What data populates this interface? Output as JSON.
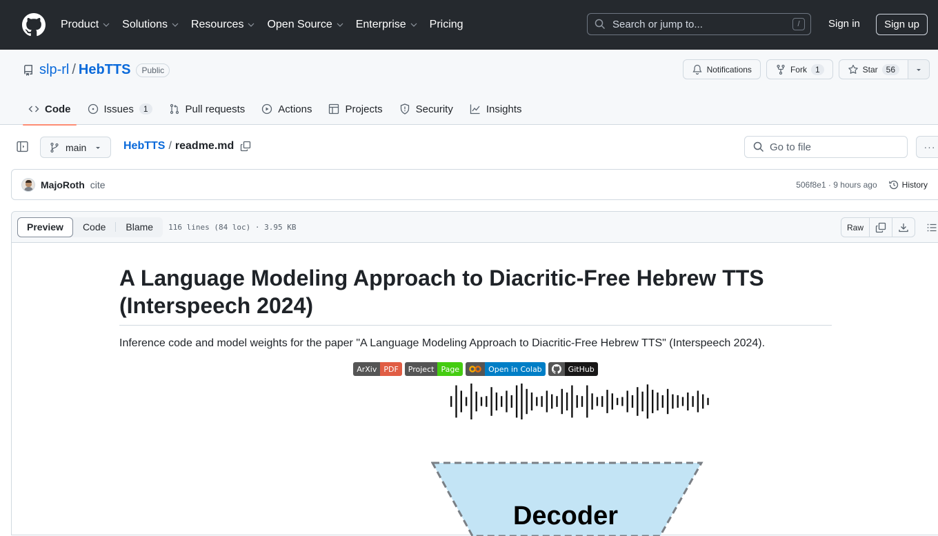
{
  "header": {
    "nav": [
      {
        "label": "Product",
        "has_dropdown": true
      },
      {
        "label": "Solutions",
        "has_dropdown": true
      },
      {
        "label": "Resources",
        "has_dropdown": true
      },
      {
        "label": "Open Source",
        "has_dropdown": true
      },
      {
        "label": "Enterprise",
        "has_dropdown": true
      },
      {
        "label": "Pricing",
        "has_dropdown": false
      }
    ],
    "search_placeholder": "Search or jump to...",
    "search_shortcut": "/",
    "sign_in": "Sign in",
    "sign_up": "Sign up"
  },
  "repo": {
    "owner": "slp-rl",
    "separator": "/",
    "name": "HebTTS",
    "visibility": "Public",
    "notifications_label": "Notifications",
    "fork_label": "Fork",
    "fork_count": "1",
    "star_label": "Star",
    "star_count": "56"
  },
  "tabs": [
    {
      "label": "Code",
      "icon": "code-icon",
      "active": true
    },
    {
      "label": "Issues",
      "icon": "issue-icon",
      "count": "1"
    },
    {
      "label": "Pull requests",
      "icon": "pull-request-icon"
    },
    {
      "label": "Actions",
      "icon": "play-icon"
    },
    {
      "label": "Projects",
      "icon": "table-icon"
    },
    {
      "label": "Security",
      "icon": "shield-icon"
    },
    {
      "label": "Insights",
      "icon": "graph-icon"
    }
  ],
  "file_nav": {
    "branch": "main",
    "breadcrumb_repo": "HebTTS",
    "breadcrumb_sep": "/",
    "file_name": "readme.md",
    "goto_placeholder": "Go to file",
    "more": "···"
  },
  "commit": {
    "author": "MajoRoth",
    "message": "cite",
    "sha": "506f8e1",
    "dot": "·",
    "time": "9 hours ago",
    "history_label": "History"
  },
  "file_toolbar": {
    "views": [
      "Preview",
      "Code",
      "Blame"
    ],
    "active_view": "Preview",
    "meta": "116 lines (84 loc) · 3.95 KB",
    "raw_label": "Raw"
  },
  "readme": {
    "title": "A Language Modeling Approach to Diacritic-Free Hebrew TTS (Interspeech 2024)",
    "description": "Inference code and model weights for the paper \"A Language Modeling Approach to Diacritic-Free Hebrew TTS\" (Interspeech 2024).",
    "badges": [
      {
        "left": "ArXiv",
        "right": "PDF",
        "color": "#e05d44"
      },
      {
        "left": "Project",
        "right": "Page",
        "color": "#4c1"
      },
      {
        "left": "",
        "right": "Open in Colab",
        "color": "#007ec6",
        "icon": "colab-icon"
      },
      {
        "left": "",
        "right": "GitHub",
        "color": "#181717",
        "icon": "github-icon"
      }
    ],
    "diagram_label": "Decoder"
  },
  "colors": {
    "header_bg": "#25292e",
    "link": "#0969da",
    "tab_underline": "#fd8c73",
    "decoder_fill": "#c3e4f5"
  }
}
